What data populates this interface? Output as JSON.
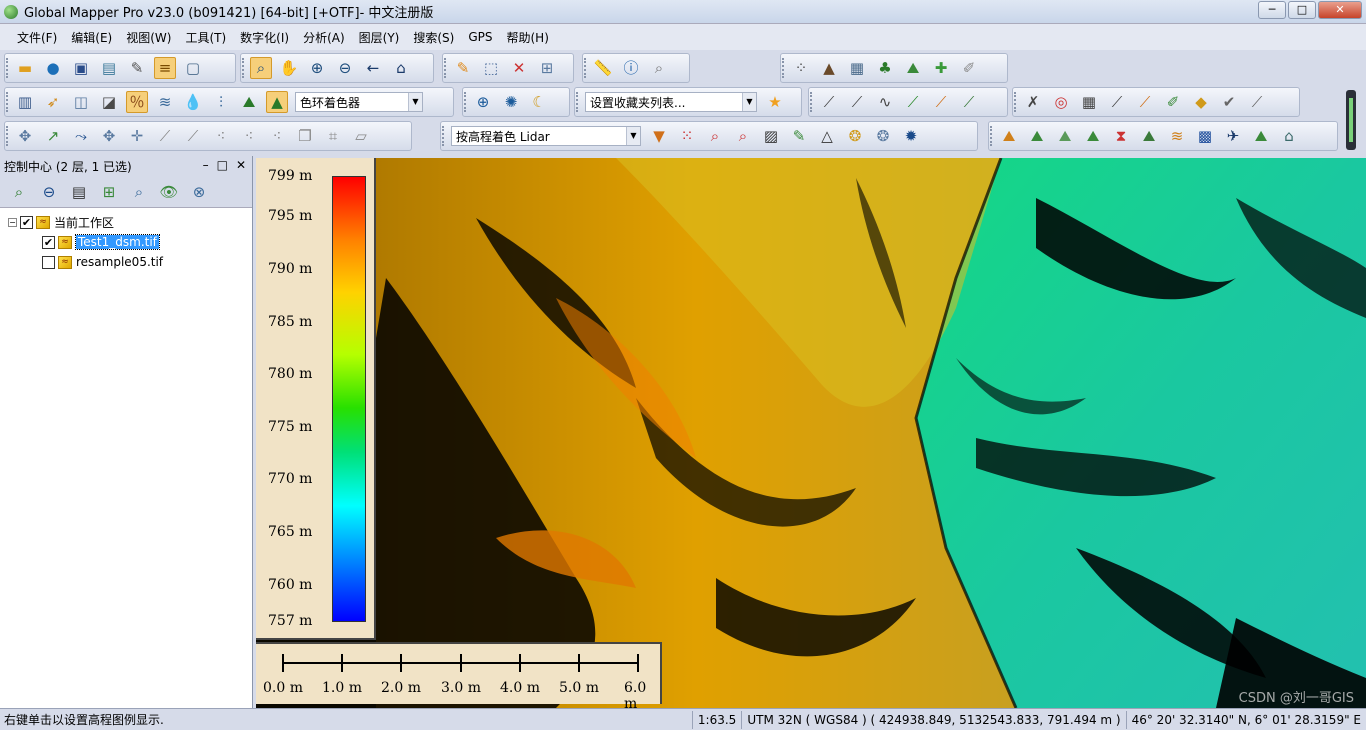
{
  "window": {
    "title": "Global Mapper Pro v23.0 (b091421) [64-bit] [+OTF]- 中文注册版",
    "btn_min": "─",
    "btn_max": "□",
    "btn_close": "✕"
  },
  "menu": [
    "文件(F)",
    "编辑(E)",
    "视图(W)",
    "工具(T)",
    "数字化(I)",
    "分析(A)",
    "图层(Y)",
    "搜索(S)",
    "GPS",
    "帮助(H)"
  ],
  "toolbar": {
    "shader_combo": "色环着色器",
    "favorites_combo": "设置收藏夹列表...",
    "lidar_combo": "按高程着色 Lidar"
  },
  "control_center": {
    "title": "控制中心 (2 层, 1 已选)",
    "btn_min": "–",
    "btn_restore": "□",
    "btn_close": "✕",
    "root_label": "当前工作区",
    "layers": [
      {
        "name": "Test1_dsm.tif",
        "checked": true,
        "selected": true
      },
      {
        "name": "resample05.tif",
        "checked": false,
        "selected": false
      }
    ]
  },
  "legend": {
    "labels": [
      "799 m",
      "795 m",
      "790 m",
      "785 m",
      "780 m",
      "775 m",
      "770 m",
      "765 m",
      "760 m",
      "757 m"
    ]
  },
  "scale_bar": {
    "labels": [
      "0.0 m",
      "1.0 m",
      "2.0 m",
      "3.0 m",
      "4.0 m",
      "5.0 m",
      "6.0 m"
    ]
  },
  "watermark": "CSDN @刘一哥GIS",
  "status": {
    "message": "右键单击以设置高程图例显示.",
    "scale": "1:63.5",
    "projection": "UTM 32N ( WGS84 ) ( 424938.849, 5132543.833, 791.494 m )",
    "latlon": "46° 20' 32.3140\" N, 6° 01' 28.3159\" E"
  }
}
